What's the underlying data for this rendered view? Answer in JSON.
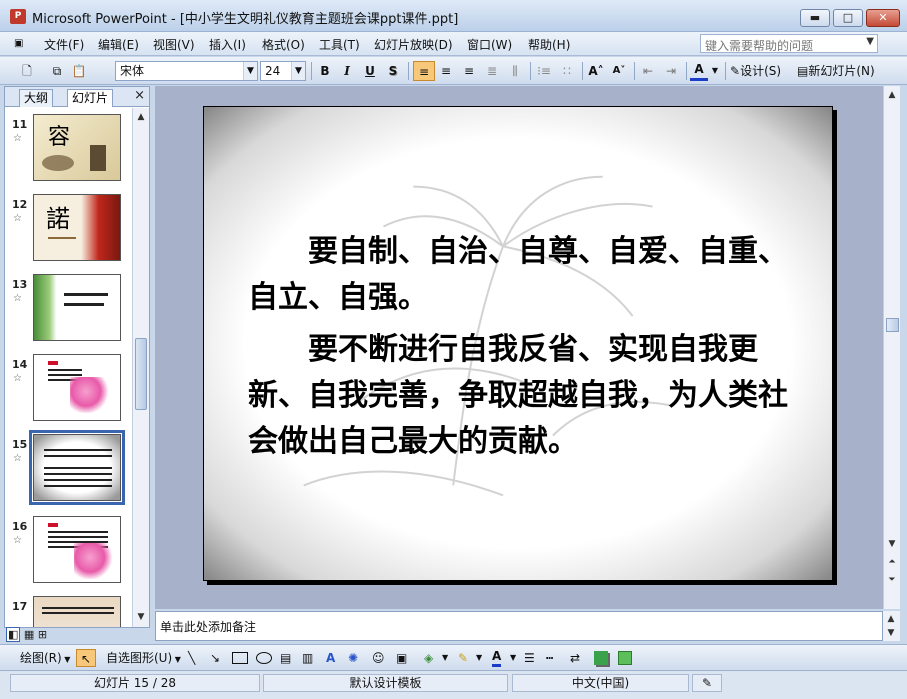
{
  "window": {
    "title": "Microsoft PowerPoint - [中小学生文明礼仪教育主题班会课ppt课件.ppt]",
    "app_icon": "powerpoint-icon",
    "controls": {
      "minimize": "▬",
      "maximize": "□",
      "close": "✕"
    }
  },
  "menubar": {
    "items": [
      "文件(F)",
      "编辑(E)",
      "视图(V)",
      "插入(I)",
      "格式(O)",
      "工具(T)",
      "幻灯片放映(D)",
      "窗口(W)",
      "帮助(H)"
    ],
    "help_placeholder": "键入需要帮助的问题"
  },
  "toolbar": {
    "font_name": "宋体",
    "font_size": "24",
    "bold": "B",
    "italic": "I",
    "underline": "U",
    "shadow": "S",
    "design_label": "设计(S)",
    "new_slide_label": "新幻灯片(N)"
  },
  "left_panel": {
    "tab_outline": "大纲",
    "tab_slides": "幻灯片",
    "close": "×",
    "thumbnails": [
      {
        "number": "11",
        "glyph": "容"
      },
      {
        "number": "12",
        "glyph": "諾"
      },
      {
        "number": "13",
        "glyph": ""
      },
      {
        "number": "14",
        "glyph": ""
      },
      {
        "number": "15",
        "glyph": ""
      },
      {
        "number": "16",
        "glyph": ""
      },
      {
        "number": "17",
        "glyph": ""
      }
    ],
    "selected": "15"
  },
  "slide": {
    "paragraph1": "要自制、自治、自尊、自爱、自重、自立、自强。",
    "paragraph2": "要不断进行自我反省、实现自我更新、自我完善，争取超越自我，为人类社会做出自己最大的贡献。"
  },
  "notes": {
    "placeholder": "单击此处添加备注"
  },
  "drawbar": {
    "draw_label": "绘图(R)",
    "autoshape_label": "自选图形(U)"
  },
  "statusbar": {
    "slide_position": "幻灯片 15 / 28",
    "template": "默认设计模板",
    "language": "中文(中国)"
  },
  "colors": {
    "accent": "#3a66b0",
    "close_button": "#c44a36",
    "editor_bg": "#a7b1c9"
  }
}
